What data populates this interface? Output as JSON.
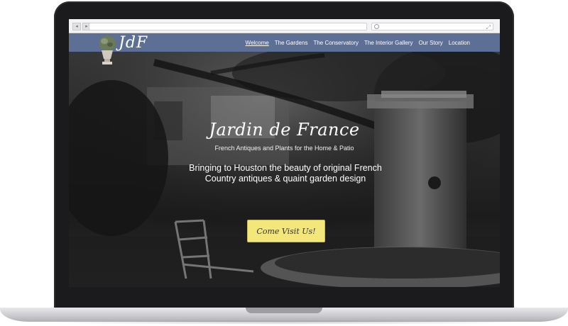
{
  "site": {
    "logo_text": "JdF",
    "nav": [
      {
        "label": "Welcome",
        "active": true
      },
      {
        "label": "The Gardens",
        "active": false
      },
      {
        "label": "The Conservatory",
        "active": false
      },
      {
        "label": "The Interior Gallery",
        "active": false
      },
      {
        "label": "Our Story",
        "active": false
      },
      {
        "label": "Location",
        "active": false
      }
    ]
  },
  "browser": {
    "back_label": "◂",
    "forward_label": "▸",
    "resize_icon": "⤢"
  },
  "hero": {
    "title": "Jardin de France",
    "subtitle": "French Antiques and Plants for the Home & Patio",
    "tagline": "Bringing to Houston the beauty of original French Country antiques & quaint garden design",
    "cta_label": "Come Visit Us!"
  },
  "colors": {
    "header_bg": "#5d6f95",
    "cta_bg": "#f3e77c"
  }
}
